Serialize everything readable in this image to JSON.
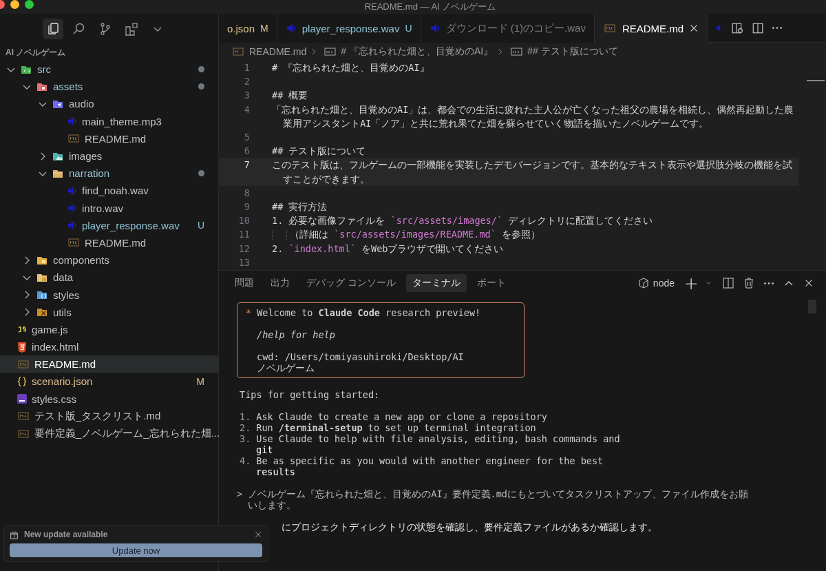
{
  "window": {
    "title": "README.md — AI ノベルゲーム"
  },
  "activity_bar": {
    "items": [
      {
        "kind": "explorer",
        "selected": true
      },
      {
        "kind": "search",
        "selected": false
      },
      {
        "kind": "source-control",
        "selected": false
      },
      {
        "kind": "extensions",
        "selected": false
      },
      {
        "kind": "more",
        "selected": false
      }
    ]
  },
  "explorer": {
    "title": "AI ノベルゲーム",
    "tree": [
      {
        "name": "src",
        "kind": "folder-src",
        "expanded": true,
        "dot": true,
        "color": "#9cc7d8",
        "selected": false,
        "children": [
          {
            "name": "assets",
            "kind": "folder-assets",
            "expanded": true,
            "dot": true,
            "color": "#9cc7d8",
            "selected": false,
            "children": [
              {
                "name": "audio",
                "kind": "folder-audio",
                "expanded": true,
                "selected": false,
                "children": [
                  {
                    "name": "main_theme.mp3",
                    "kind": "audio",
                    "selected": false
                  },
                  {
                    "name": "README.md",
                    "kind": "md",
                    "selected": false
                  }
                ]
              },
              {
                "name": "images",
                "kind": "folder-images",
                "expanded": false,
                "selected": false
              },
              {
                "name": "narration",
                "kind": "folder",
                "expanded": true,
                "dot": true,
                "color": "#9cc7d8",
                "selected": false,
                "children": [
                  {
                    "name": "find_noah.wav",
                    "kind": "audio",
                    "selected": false
                  },
                  {
                    "name": "intro.wav",
                    "kind": "audio",
                    "selected": false
                  },
                  {
                    "name": "player_response.wav",
                    "kind": "audio",
                    "color": "#8cc2d6",
                    "badge": "U",
                    "selected": false
                  },
                  {
                    "name": "README.md",
                    "kind": "md",
                    "selected": false
                  }
                ]
              }
            ]
          },
          {
            "name": "components",
            "kind": "folder-components",
            "expanded": false,
            "selected": false
          },
          {
            "name": "data",
            "kind": "folder-data",
            "expanded": true,
            "selected": false
          },
          {
            "name": "styles",
            "kind": "folder-styles",
            "expanded": false,
            "selected": false
          },
          {
            "name": "utils",
            "kind": "folder-utils",
            "expanded": false,
            "selected": false
          }
        ]
      },
      {
        "name": "game.js",
        "kind": "js",
        "selected": false
      },
      {
        "name": "index.html",
        "kind": "html",
        "selected": false
      },
      {
        "name": "README.md",
        "kind": "md",
        "selected": true
      },
      {
        "name": "scenario.json",
        "kind": "json",
        "color": "#e2c08d",
        "badge": "M",
        "selected": false
      },
      {
        "name": "styles.css",
        "kind": "css",
        "selected": false
      },
      {
        "name": "テスト版_タスクリスト.md",
        "kind": "md",
        "selected": false
      },
      {
        "name": "要件定義_ノベルゲーム_忘れられた畑...",
        "kind": "md",
        "selected": false
      }
    ]
  },
  "tabs": [
    {
      "label": "o.json",
      "kind": "none",
      "badge": "M",
      "color": "#e2c08d",
      "selected": false
    },
    {
      "label": "player_response.wav",
      "kind": "audio",
      "badge": "U",
      "color": "#8cc2d6",
      "selected": false
    },
    {
      "label": "ダウンロード (1)のコピー.wav",
      "kind": "audio",
      "color": "#7a7a7a",
      "selected": false
    },
    {
      "label": "README.md",
      "kind": "md",
      "color": "#ffffff",
      "selected": true
    }
  ],
  "breadcrumb": [
    {
      "label": "README.md",
      "kind": "md"
    },
    {
      "label": "# 『忘れられた畑と、目覚めのAI』",
      "kind": "heading"
    },
    {
      "label": "## テスト版について",
      "kind": "heading"
    }
  ],
  "editor": {
    "lines": [
      {
        "number": "1",
        "current": false,
        "segments": [
          {
            "text": "# 『忘れられた畑と、目覚めのAI』",
            "kind": "text"
          }
        ]
      },
      {
        "number": "2",
        "current": false
      },
      {
        "number": "3",
        "current": false,
        "segments": [
          {
            "text": "## 概要",
            "kind": "text"
          }
        ]
      },
      {
        "number": "4",
        "current": false,
        "segments": [
          {
            "text": "「忘れられた畑と、目覚めのAI」は、都会での生活に疲れた主人公が亡くなった祖父の農場を相続し、偶然再起動した農業用アシスタントAI「ノア」と共に荒れ果てた畑を蘇らせていく物語を描いたノベルゲームです。",
            "kind": "text"
          }
        ]
      },
      {
        "number": "5",
        "current": false
      },
      {
        "number": "6",
        "current": false,
        "segments": [
          {
            "text": "## テスト版について",
            "kind": "text"
          }
        ]
      },
      {
        "number": "7",
        "current": true,
        "segments": [
          {
            "text": "このテスト版は、フルゲームの一部機能を実装したデモバージョンです。基本的なテキスト表示や選択肢分岐の機能を試すことができます。",
            "kind": "text"
          }
        ]
      },
      {
        "number": "8",
        "current": false
      },
      {
        "number": "9",
        "current": false,
        "segments": [
          {
            "text": "## 実行方法",
            "kind": "text"
          }
        ]
      },
      {
        "number": "10",
        "current": false,
        "segments": [
          {
            "text": "1. 必要な画像ファイルを ",
            "kind": "text"
          },
          {
            "text": "`src/assets/images/`",
            "kind": "code"
          },
          {
            "text": " ディレクトリに配置してください",
            "kind": "text"
          }
        ]
      },
      {
        "number": "11",
        "current": false,
        "indented": true,
        "segments": [
          {
            "text": "（詳細は ",
            "kind": "text"
          },
          {
            "text": "`src/assets/images/README.md`",
            "kind": "code"
          },
          {
            "text": " を参照）",
            "kind": "text"
          }
        ]
      },
      {
        "number": "12",
        "current": false,
        "segments": [
          {
            "text": "2. ",
            "kind": "text"
          },
          {
            "text": "`index.html`",
            "kind": "code"
          },
          {
            "text": " をWebブラウザで開いてください",
            "kind": "text"
          }
        ]
      },
      {
        "number": "13",
        "current": false
      }
    ]
  },
  "panel": {
    "tabs": [
      {
        "label": "問題",
        "selected": false
      },
      {
        "label": "出力",
        "selected": false
      },
      {
        "label": "デバッグ コンソール",
        "selected": false
      },
      {
        "label": "ターミナル",
        "selected": true
      },
      {
        "label": "ポート",
        "selected": false
      }
    ],
    "shell": "node",
    "terminal": {
      "welcome": {
        "star": "*",
        "title": "Welcome to **Claude Code** research preview!",
        "help": "/help for help",
        "cwd": "cwd: /Users/tomiyasuhiroki/Desktop/AI\nノベルゲーム"
      },
      "lines": [
        {
          "kind": "plain",
          "text": "Tips for getting started:"
        },
        {
          "kind": "blank"
        },
        {
          "kind": "item",
          "number": "1.",
          "text": "Ask Claude to create a new app or clone a repository"
        },
        {
          "kind": "item",
          "number": "2.",
          "text": "Run **/terminal-setup** to set up terminal integration"
        },
        {
          "kind": "item",
          "number": "3.",
          "text": "Use Claude to help with file analysis, editing, bash commands and"
        },
        {
          "kind": "cont",
          "text": "git"
        },
        {
          "kind": "item",
          "number": "4.",
          "text": "Be as specific as you would with another engineer for the best"
        },
        {
          "kind": "cont",
          "text": "results"
        },
        {
          "kind": "blank"
        },
        {
          "kind": "prompt",
          "text": "> ノベルゲーム『忘れられた畑と、目覚めのAI』要件定義.mdにもとづいてタスクリストアップ、ファイル作成をお願"
        },
        {
          "kind": "prompt",
          "text": "  いします。"
        },
        {
          "kind": "blank"
        },
        {
          "kind": "covered",
          "text": "にプロジェクトディレクトリの状態を確認し、要件定義ファイルがあるか確認します。"
        }
      ]
    }
  },
  "notification": {
    "title": "New update available",
    "button": "Update now"
  }
}
